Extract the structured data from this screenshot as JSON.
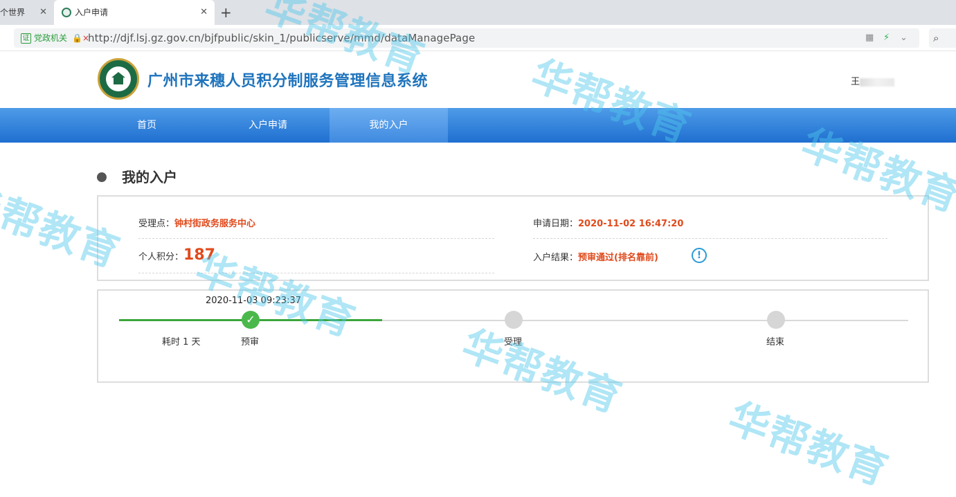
{
  "browser": {
    "tabs": [
      {
        "label": "个世界"
      },
      {
        "label": "入户申请"
      }
    ],
    "new_tab": "+",
    "security_label": "党政机关",
    "security_badge": "证",
    "url": "http://djf.lsj.gz.gov.cn/bjfpublic/skin_1/publicserve/mmd/dataManagePage"
  },
  "header": {
    "site_title": "广州市来穗人员积分制服务管理信息系统",
    "user_name": "王"
  },
  "nav": {
    "items": [
      "首页",
      "入户申请",
      "我的入户"
    ],
    "active_index": 2
  },
  "main": {
    "section_title": "我的入户",
    "info": {
      "accept_label": "受理点：",
      "accept_value": "钟村街政务服务中心",
      "date_label": "申请日期：",
      "date_value": "2020-11-02 16:47:20",
      "score_label": "个人积分：",
      "score_value": "187",
      "result_label": "入户结果：",
      "result_value": "预审通过(排名靠前)",
      "info_icon": "!"
    },
    "progress": {
      "step_time": "2020-11-03 09:23:37",
      "elapsed": "耗时 1 天",
      "steps": [
        {
          "label": "预审",
          "status": "done"
        },
        {
          "label": "受理",
          "status": "pending"
        },
        {
          "label": "结束",
          "status": "pending"
        }
      ]
    }
  },
  "watermark": "华帮教育",
  "colors": {
    "nav_blue": "#1f6fd0",
    "title_blue": "#1f74bd",
    "highlight": "#e04a1c",
    "done_green": "#3aa63a"
  }
}
